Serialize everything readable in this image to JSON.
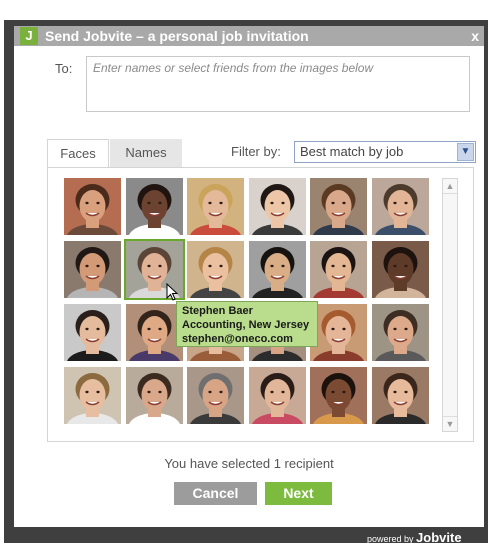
{
  "dialog": {
    "icon_letter": "J",
    "title": "Send Jobvite – a personal job invitation",
    "close": "x"
  },
  "to": {
    "label": "To:",
    "placeholder": "Enter names or select friends from the images below"
  },
  "tabs": [
    {
      "label": "Faces",
      "active": true
    },
    {
      "label": "Names",
      "active": false
    }
  ],
  "filter": {
    "label": "Filter by:",
    "selected": "Best match by job"
  },
  "faces": [
    {
      "skin": "#d9a07e",
      "hair": "#4a2a1a",
      "bg": "#b56d52",
      "shirt": "#6b4a3a"
    },
    {
      "skin": "#6b4330",
      "hair": "#1f1410",
      "bg": "#8a8a8a",
      "shirt": "#ffffff"
    },
    {
      "skin": "#e3b99a",
      "hair": "#c9a45a",
      "bg": "#d2b27f",
      "shirt": "#c94c3d"
    },
    {
      "skin": "#ecc6a6",
      "hair": "#1e1714",
      "bg": "#d9d2cc",
      "shirt": "#3a3a3a"
    },
    {
      "skin": "#d9a88a",
      "hair": "#5a3a22",
      "bg": "#9a8470",
      "shirt": "#2f3a4a"
    },
    {
      "skin": "#e2b597",
      "hair": "#4c3a2c",
      "bg": "#bba89a",
      "shirt": "#3b4f6b"
    },
    {
      "skin": "#d29a77",
      "hair": "#201814",
      "bg": "#8a7a6e",
      "shirt": "#b5b5b5"
    },
    {
      "skin": "#e0b296",
      "hair": "#5b4536",
      "bg": "#a3a39a",
      "shirt": "#d9d9d9"
    },
    {
      "skin": "#eac0a0",
      "hair": "#b58447",
      "bg": "#cfb48d",
      "shirt": "#444444"
    },
    {
      "skin": "#d9ad85",
      "hair": "#161210",
      "bg": "#9f9f9f",
      "shirt": "#222222"
    },
    {
      "skin": "#e4b794",
      "hair": "#1a1311",
      "bg": "#b7a493",
      "shirt": "#a33b32"
    },
    {
      "skin": "#5e3a28",
      "hair": "#1d120e",
      "bg": "#7a5a49",
      "shirt": "#d1b49a"
    },
    {
      "skin": "#e4bb9d",
      "hair": "#2a1f1a",
      "bg": "#c9c9c9",
      "shirt": "#1c1c1c"
    },
    {
      "skin": "#dfa985",
      "hair": "#33241b",
      "bg": "#b28f78",
      "shirt": "#4a3a6a"
    },
    {
      "skin": "#e7bd9f",
      "hair": "#6b4b2e",
      "bg": "#c7a588",
      "shirt": "#9a5d3a"
    },
    {
      "skin": "#d7a585",
      "hair": "#2b1e17",
      "bg": "#a58f7e",
      "shirt": "#2c2c2c"
    },
    {
      "skin": "#e4b596",
      "hair": "#a55b2f",
      "bg": "#c99b74",
      "shirt": "#8a3c2c"
    },
    {
      "skin": "#dda98b",
      "hair": "#3d2d22",
      "bg": "#9e9486",
      "shirt": "#5a5a5a"
    },
    {
      "skin": "#e7bea0",
      "hair": "#8a6a3e",
      "bg": "#cfc3b1",
      "shirt": "#e8e8e8"
    },
    {
      "skin": "#d9a88b",
      "hair": "#3b2a20",
      "bg": "#b9ab9b",
      "shirt": "#ffffff"
    },
    {
      "skin": "#d8a486",
      "hair": "#6f6f6f",
      "bg": "#a9988a",
      "shirt": "#3a3a3a"
    },
    {
      "skin": "#e2b699",
      "hair": "#2a1c16",
      "bg": "#c8a996",
      "shirt": "#c84a63"
    },
    {
      "skin": "#7a4a32",
      "hair": "#1c120d",
      "bg": "#a0705a",
      "shirt": "#d89a4a"
    },
    {
      "skin": "#e6ba9b",
      "hair": "#3a261b",
      "bg": "#9a7a64",
      "shirt": "#2a2a2a"
    }
  ],
  "selected_index": 7,
  "tooltip": {
    "name": "Stephen Baer",
    "job": "Accounting, New Jersey",
    "email": "stephen@oneco.com"
  },
  "status": "You have selected 1 recipient",
  "buttons": {
    "cancel": "Cancel",
    "next": "Next"
  },
  "footer": {
    "powered": "powered by",
    "brand": "Jobvite"
  }
}
